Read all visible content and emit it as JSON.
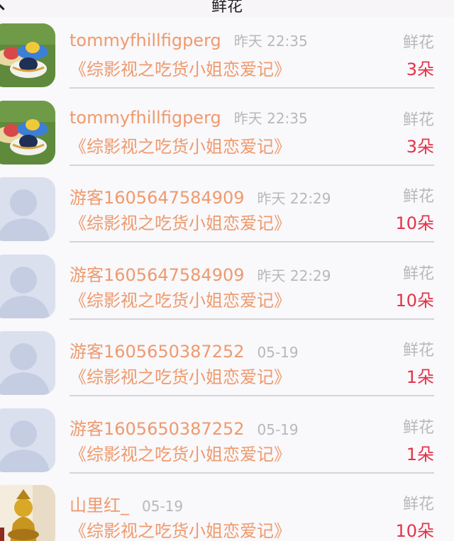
{
  "header": {
    "title": "鲜花"
  },
  "records": [
    {
      "name": "tommyfhillfigperg",
      "time": "昨天 22:35",
      "type": "鲜花",
      "book": "《综影视之吃货小姐恋爱记》",
      "count": "3朵",
      "avatar": "hats-photo"
    },
    {
      "name": "tommyfhillfigperg",
      "time": "昨天 22:35",
      "type": "鲜花",
      "book": "《综影视之吃货小姐恋爱记》",
      "count": "3朵",
      "avatar": "hats-photo"
    },
    {
      "name": "游客1605647584909",
      "time": "昨天 22:29",
      "type": "鲜花",
      "book": "《综影视之吃货小姐恋爱记》",
      "count": "10朵",
      "avatar": "default-user"
    },
    {
      "name": "游客1605647584909",
      "time": "昨天 22:29",
      "type": "鲜花",
      "book": "《综影视之吃货小姐恋爱记》",
      "count": "10朵",
      "avatar": "default-user"
    },
    {
      "name": "游客1605650387252",
      "time": "05-19",
      "type": "鲜花",
      "book": "《综影视之吃货小姐恋爱记》",
      "count": "1朵",
      "avatar": "default-user"
    },
    {
      "name": "游客1605650387252",
      "time": "05-19",
      "type": "鲜花",
      "book": "《综影视之吃货小姐恋爱记》",
      "count": "1朵",
      "avatar": "default-user"
    },
    {
      "name": "山里红_",
      "time": "05-19",
      "type": "鲜花",
      "book": "《综影视之吃货小姐恋爱记》",
      "count": "10朵",
      "avatar": "gold-statue-photo"
    }
  ],
  "colors": {
    "name": "#ee9a6e",
    "count": "#e3334a",
    "muted": "#b8b8bc"
  }
}
